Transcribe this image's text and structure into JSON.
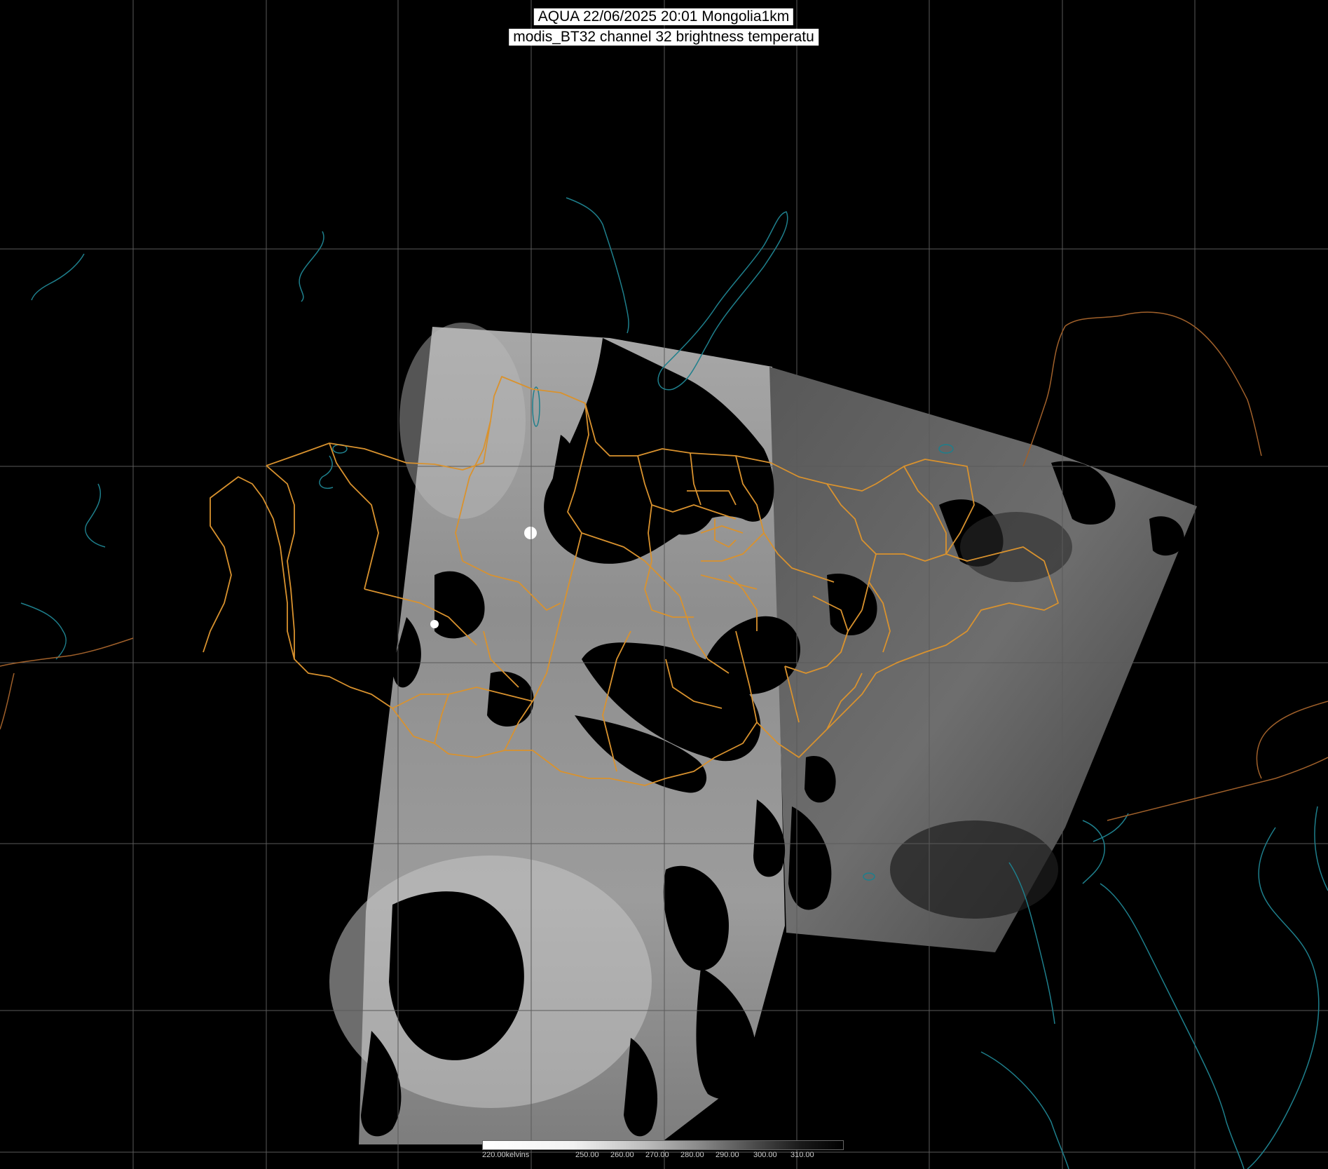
{
  "title": {
    "line1": "AQUA 22/06/2025 20:01 Mongolia1km",
    "line2": "modis_BT32 channel 32 brightness temperatu"
  },
  "colorbar": {
    "labels": [
      "220.00kelvins",
      "250.00",
      "260.00",
      "270.00",
      "280.00",
      "290.00",
      "300.00",
      "310.00"
    ]
  },
  "colors": {
    "background": "#000000",
    "grid": "#5a5a5a",
    "coastline": "#1e7f8c",
    "admin_border": "#d9922e",
    "international_border": "#a0602a"
  }
}
